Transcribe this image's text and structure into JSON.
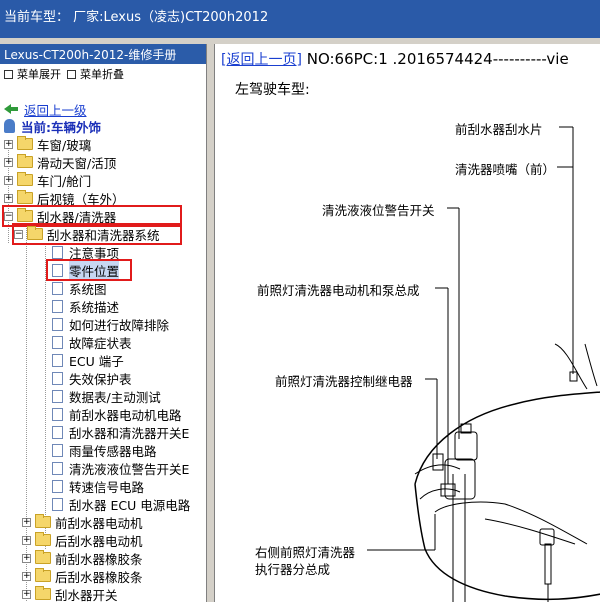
{
  "topbar": {
    "title": "当前车型：  厂家:Lexus（凌志)CT200h2012"
  },
  "left": {
    "title": "Lexus-CT200h-2012-维修手册",
    "menu": [
      {
        "label": "菜单展开"
      },
      {
        "label": "菜单折叠"
      }
    ],
    "back_link": "返回上一级",
    "current": "当前:车辆外饰",
    "tree": [
      {
        "label": "车窗/玻璃"
      },
      {
        "label": "滑动天窗/活顶"
      },
      {
        "label": "车门/舱门"
      },
      {
        "label": "后视镜（车外）"
      },
      {
        "label": "刮水器/清洗器"
      },
      {
        "label": "刮水器和清洗器系统"
      },
      {
        "label": "注意事项"
      },
      {
        "label": "零件位置"
      },
      {
        "label": "系统图"
      },
      {
        "label": "系统描述"
      },
      {
        "label": "如何进行故障排除"
      },
      {
        "label": "故障症状表"
      },
      {
        "label": "ECU 端子"
      },
      {
        "label": "失效保护表"
      },
      {
        "label": "数据表/主动测试"
      },
      {
        "label": "前刮水器电动机电路"
      },
      {
        "label": "刮水器和清洗器开关E"
      },
      {
        "label": "雨量传感器电路"
      },
      {
        "label": "清洗液液位警告开关E"
      },
      {
        "label": "转速信号电路"
      },
      {
        "label": "刮水器 ECU 电源电路"
      },
      {
        "label": "前刮水器电动机"
      },
      {
        "label": "后刮水器电动机"
      },
      {
        "label": "前刮水器橡胶条"
      },
      {
        "label": "后刮水器橡胶条"
      },
      {
        "label": "刮水器开关"
      }
    ]
  },
  "right": {
    "back_link": "[返回上一页]",
    "code": "NO:66PC:1 .2016574424----------vie",
    "subtitle": "左驾驶车型:",
    "callouts": [
      {
        "label": "前刮水器刮水片"
      },
      {
        "label": "清洗器喷嘴（前）"
      },
      {
        "label": "清洗液液位警告开关"
      },
      {
        "label": "前照灯清洗器电动机和泵总成"
      },
      {
        "label": "前照灯清洗器控制继电器"
      },
      {
        "label": "右侧前照灯清洗器"
      },
      {
        "label": "执行器分总成"
      }
    ]
  }
}
